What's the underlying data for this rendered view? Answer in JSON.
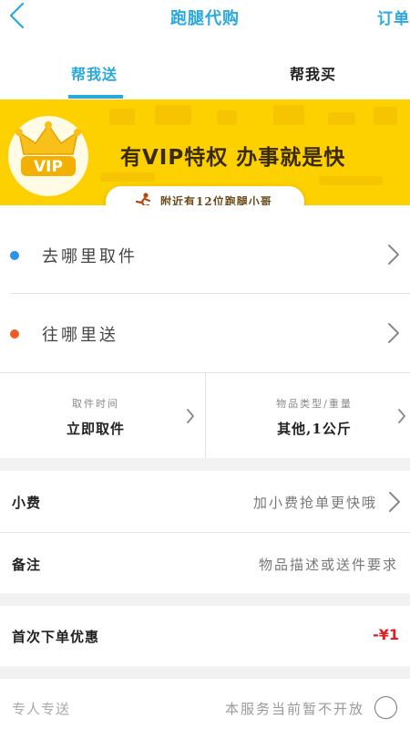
{
  "header": {
    "title": "跑腿代购",
    "orders_label": "订单"
  },
  "tabs": [
    {
      "label": "帮我送",
      "active": true
    },
    {
      "label": "帮我买",
      "active": false
    }
  ],
  "banner": {
    "badge_text": "VIP",
    "slogan": "有VIP特权  办事就是快",
    "runner_notice": "附近有12位跑腿小哥"
  },
  "address": {
    "pickup_label": "去哪里取件",
    "delivery_label": "往哪里送"
  },
  "info": {
    "pickup_time": {
      "label": "取件时间",
      "value": "立即取件"
    },
    "item_type": {
      "label": "物品类型/重量",
      "value": "其他,1公斤"
    }
  },
  "tip": {
    "label": "小费",
    "hint": "加小费抢单更快哦"
  },
  "note": {
    "label": "备注",
    "hint": "物品描述或送件要求"
  },
  "first_order": {
    "label": "首次下单优惠",
    "value": "-¥1"
  },
  "dedicated": {
    "label": "专人专送",
    "hint": "本服务当前暂不开放"
  },
  "colors": {
    "accent": "#29a8e0",
    "banner": "#fdd000",
    "pickup_dot": "#2a95e8",
    "delivery_dot": "#f25c22",
    "discount": "#e02020"
  }
}
